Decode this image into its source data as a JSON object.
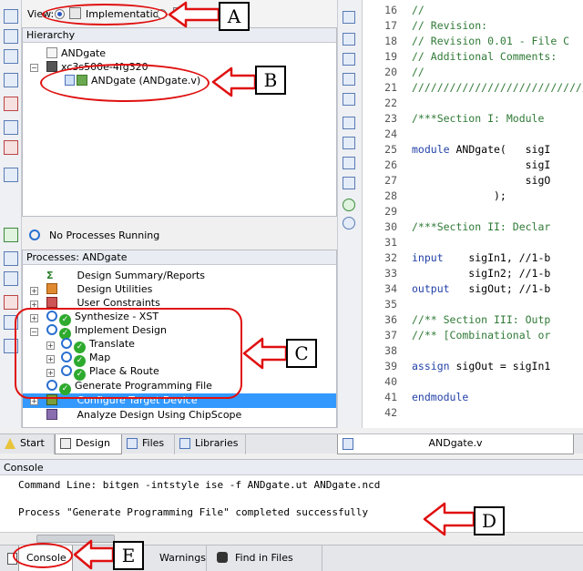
{
  "view": {
    "label": "View:",
    "implementation_label": "Implementation"
  },
  "hierarchy": {
    "title": "Hierarchy",
    "project": "ANDgate",
    "device": "xc3s500e-4fg320",
    "module": "ANDgate (ANDgate.v)"
  },
  "status": {
    "no_processes": "No Processes Running"
  },
  "processes": {
    "title": "Processes: ANDgate",
    "items": [
      "Design Summary/Reports",
      "Design Utilities",
      "User Constraints",
      "Synthesize - XST",
      "Implement Design",
      "Translate",
      "Map",
      "Place & Route",
      "Generate Programming File",
      "Configure Target Device",
      "Analyze Design Using ChipScope"
    ]
  },
  "left_tabs": [
    "Start",
    "Design",
    "Files",
    "Libraries"
  ],
  "editor": {
    "tab": "ANDgate.v",
    "lines": [
      {
        "n": "16",
        "t": "//",
        "k": "com"
      },
      {
        "n": "17",
        "t": "// Revision:",
        "k": "com"
      },
      {
        "n": "18",
        "t": "// Revision 0.01 - File C",
        "k": "com"
      },
      {
        "n": "19",
        "t": "// Additional Comments:",
        "k": "com"
      },
      {
        "n": "20",
        "t": "//",
        "k": "com"
      },
      {
        "n": "21",
        "t": "////////////////////////////",
        "k": "com"
      },
      {
        "n": "22",
        "t": "",
        "k": ""
      },
      {
        "n": "23",
        "t": "/***Section I: Module",
        "k": "com"
      },
      {
        "n": "24",
        "t": "",
        "k": ""
      },
      {
        "n": "25",
        "t": "module ANDgate(   sigI",
        "k": "mod"
      },
      {
        "n": "26",
        "t": "                  sigI",
        "k": ""
      },
      {
        "n": "27",
        "t": "                  sigO",
        "k": ""
      },
      {
        "n": "28",
        "t": "             );",
        "k": ""
      },
      {
        "n": "29",
        "t": "",
        "k": ""
      },
      {
        "n": "30",
        "t": "/***Section II: Declar",
        "k": "com"
      },
      {
        "n": "31",
        "t": "",
        "k": ""
      },
      {
        "n": "32",
        "t": "input    sigIn1, //1-b",
        "k": "io"
      },
      {
        "n": "33",
        "t": "         sigIn2; //1-b",
        "k": "io2"
      },
      {
        "n": "34",
        "t": "output   sigOut; //1-b",
        "k": "io"
      },
      {
        "n": "35",
        "t": "",
        "k": ""
      },
      {
        "n": "36",
        "t": "//** Section III: Outp",
        "k": "com"
      },
      {
        "n": "37",
        "t": "//** [Combinational or",
        "k": "com"
      },
      {
        "n": "38",
        "t": "",
        "k": ""
      },
      {
        "n": "39",
        "t": "assign sigOut = sigIn1",
        "k": "asg"
      },
      {
        "n": "40",
        "t": "",
        "k": ""
      },
      {
        "n": "41",
        "t": "endmodule",
        "k": "kw"
      },
      {
        "n": "42",
        "t": "",
        "k": ""
      }
    ]
  },
  "console": {
    "title": "Console",
    "line1": "Command Line: bitgen -intstyle ise -f ANDgate.ut ANDgate.ncd",
    "line2": "Process \"Generate Programming File\" completed successfully"
  },
  "bottom_tabs": [
    "Console",
    "Warnings",
    "Find in Files Results"
  ],
  "annotations": [
    "A",
    "B",
    "C",
    "D",
    "E"
  ],
  "colors": {
    "annotation": "#e01010",
    "selection": "#3399ff",
    "check": "#2eaa2e"
  }
}
